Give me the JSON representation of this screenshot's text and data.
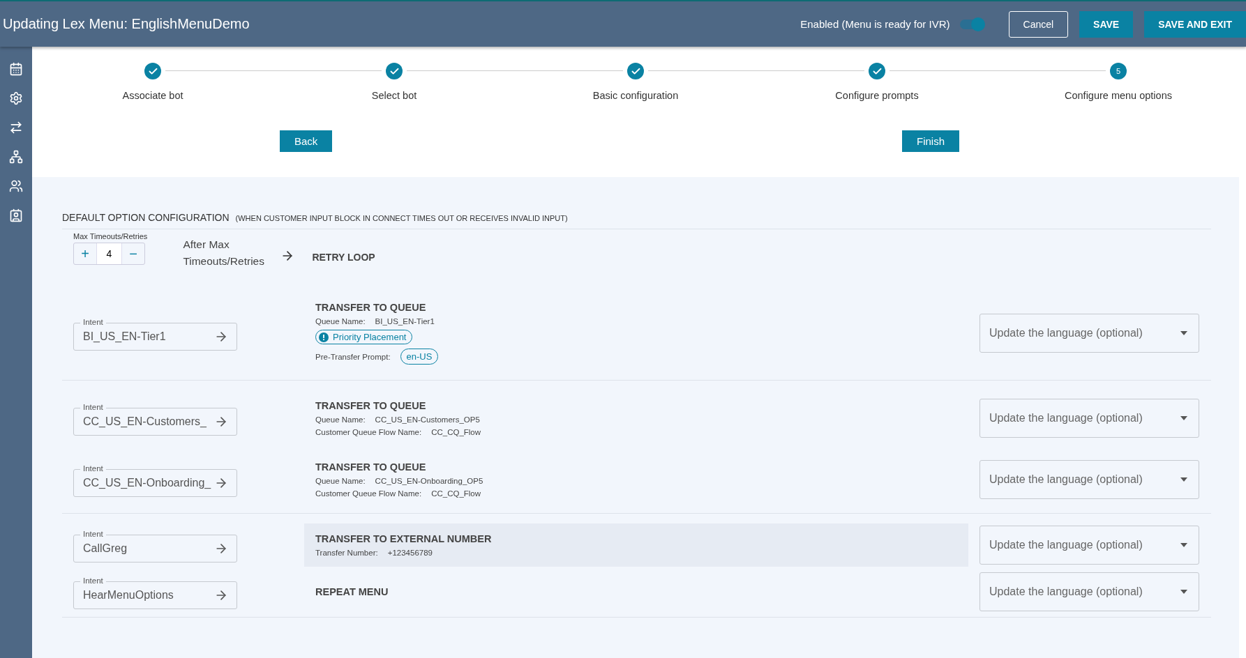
{
  "header": {
    "title": "Updating Lex Menu: EnglishMenuDemo",
    "status_label": "Enabled (Menu is ready for IVR)",
    "enabled": true,
    "buttons": [
      {
        "label": "Cancel",
        "kind": "outline"
      },
      {
        "label": "SAVE",
        "kind": "primary"
      },
      {
        "label": "SAVE AND EXIT",
        "kind": "primary"
      }
    ]
  },
  "sidebar": {
    "items": [
      {
        "kind": "calendar"
      },
      {
        "kind": "settings"
      },
      {
        "kind": "merge"
      },
      {
        "kind": "hierarchy"
      },
      {
        "kind": "people"
      },
      {
        "kind": "contact"
      }
    ]
  },
  "steps": [
    {
      "label": "Associate bot",
      "completed": true
    },
    {
      "label": "Select bot",
      "completed": true
    },
    {
      "label": "Basic configuration",
      "completed": true
    },
    {
      "label": "Configure prompts",
      "completed": true
    },
    {
      "label": "Configure menu options",
      "completed": false,
      "number": "5"
    }
  ],
  "nav_buttons": {
    "back": "Back",
    "finish": "Finish"
  },
  "default_option": {
    "title": "DEFAULT OPTION CONFIGURATION",
    "subtitle": "(WHEN CUSTOMER INPUT BLOCK IN CONNECT TIMES OUT OR RECEIVES INVALID INPUT)",
    "max_label": "Max Timeouts/Retries",
    "plus": "+",
    "value": "4",
    "minus": "−",
    "after_label": "After Max Timeouts/Retries",
    "action": "RETRY LOOP"
  },
  "groups": [
    [
      {
        "intent_label": "Intent",
        "intent": "BI_US_EN-Tier1",
        "highlighted": false,
        "action": "TRANSFER TO QUEUE",
        "details": [
          {
            "kind": "field",
            "label": "Queue Name:",
            "value": "BI_US_EN-Tier1"
          },
          {
            "kind": "badge",
            "value": "Priority Placement"
          },
          {
            "kind": "chip",
            "label": "Pre-Transfer Prompt:",
            "value": "en-US"
          }
        ],
        "language": {
          "placeholder": "Update the language (optional)"
        }
      }
    ],
    [
      {
        "intent_label": "Intent",
        "intent": "CC_US_EN-Customers_",
        "highlighted": false,
        "action": "TRANSFER TO QUEUE",
        "details": [
          {
            "kind": "field",
            "label": "Queue Name:",
            "value": "CC_US_EN-Customers_OP5"
          },
          {
            "kind": "field",
            "label": "Customer Queue Flow Name:",
            "value": "CC_CQ_Flow"
          }
        ],
        "language": {
          "placeholder": "Update the language (optional)"
        }
      },
      {
        "intent_label": "Intent",
        "intent": "CC_US_EN-Onboarding_",
        "highlighted": false,
        "action": "TRANSFER TO QUEUE",
        "details": [
          {
            "kind": "field",
            "label": "Queue Name:",
            "value": "CC_US_EN-Onboarding_OP5"
          },
          {
            "kind": "field",
            "label": "Customer Queue Flow Name:",
            "value": "CC_CQ_Flow"
          }
        ],
        "language": {
          "placeholder": "Update the language (optional)"
        }
      }
    ],
    [
      {
        "intent_label": "Intent",
        "intent": "CallGreg",
        "highlighted": true,
        "action": "TRANSFER TO EXTERNAL NUMBER",
        "details": [
          {
            "kind": "field",
            "label": "Transfer Number:",
            "value": "+123456789"
          }
        ],
        "language": {
          "placeholder": "Update the language (optional)"
        }
      },
      {
        "intent_label": "Intent",
        "intent": "HearMenuOptions",
        "highlighted": false,
        "action": "REPEAT MENU",
        "language": {
          "placeholder": "Update the language (optional)"
        }
      }
    ]
  ]
}
